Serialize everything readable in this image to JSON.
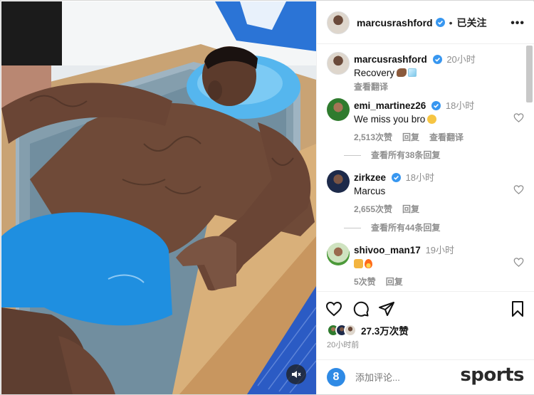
{
  "post": {
    "author": "marcusrashford",
    "separator": "•",
    "follow_state": "已关注",
    "more_icon": "more-horizontal-icon"
  },
  "caption": {
    "author": "marcusrashford",
    "time": "20小时",
    "text": "Recovery",
    "translate": "查看翻译"
  },
  "comments": [
    {
      "author": "emi_martinez26",
      "time": "18小时",
      "text": "We miss you bro",
      "likes": "2,513次赞",
      "reply": "回复",
      "translate": "查看翻译",
      "view_replies": "查看所有38条回复"
    },
    {
      "author": "zirkzee",
      "time": "18小时",
      "text": "Marcus",
      "likes": "2,655次赞",
      "reply": "回复",
      "view_replies": "查看所有44条回复"
    },
    {
      "author": "shivoo_man17",
      "time": "19小时",
      "text": "",
      "likes": "5次赞",
      "reply": "回复"
    }
  ],
  "actions": {
    "like_icon": "heart-icon",
    "comment_icon": "comment-icon",
    "share_icon": "send-icon",
    "save_icon": "bookmark-icon",
    "like_count": "27.3万次赞",
    "posted_ago": "20小时前"
  },
  "composer": {
    "placeholder": "添加评论..."
  },
  "watermark": "sports",
  "colors": {
    "verified": "#3897f0",
    "water": "#0a5fb8",
    "shorts": "#1f8fe0",
    "pillow": "#55b6ee"
  }
}
